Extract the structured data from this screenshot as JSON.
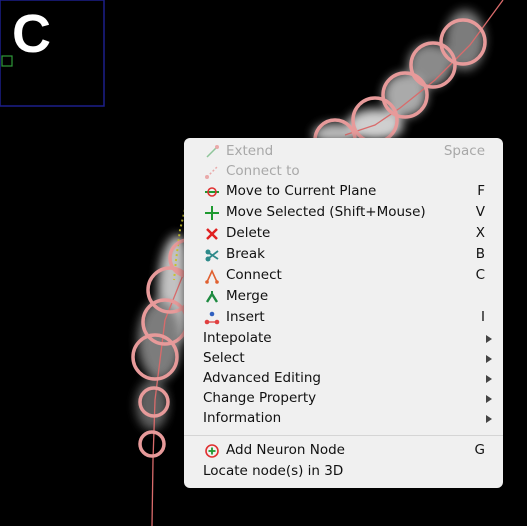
{
  "panel_label": "C",
  "menu": {
    "items": [
      {
        "label": "Extend",
        "shortcut": "Space",
        "icon": "extend-icon",
        "disabled": true
      },
      {
        "label": "Connect to",
        "shortcut": "",
        "icon": "connect-to-icon",
        "disabled": true
      },
      {
        "label": "Move to Current Plane",
        "shortcut": "F",
        "icon": "move-plane-icon"
      },
      {
        "label": "Move Selected (Shift+Mouse)",
        "shortcut": "V",
        "icon": "move-selected-icon"
      },
      {
        "label": "Delete",
        "shortcut": "X",
        "icon": "delete-icon"
      },
      {
        "label": "Break",
        "shortcut": "B",
        "icon": "break-icon"
      },
      {
        "label": "Connect",
        "shortcut": "C",
        "icon": "connect-icon"
      },
      {
        "label": "Merge",
        "shortcut": "",
        "icon": "merge-icon"
      },
      {
        "label": "Insert",
        "shortcut": "I",
        "icon": "insert-icon"
      },
      {
        "label": "Intepolate",
        "submenu": true
      },
      {
        "label": "Select",
        "submenu": true
      },
      {
        "label": "Advanced Editing",
        "submenu": true
      },
      {
        "label": "Change Property",
        "submenu": true
      },
      {
        "label": "Information",
        "submenu": true
      },
      {
        "label": "Add Neuron Node",
        "shortcut": "G",
        "icon": "add-node-icon"
      },
      {
        "label": "Locate node(s) in 3D"
      }
    ]
  },
  "colors": {
    "node_circle": "#e79a9a",
    "trace_line": "#d96b6b",
    "frame": "#1c1f8a",
    "marker": "#2f9a3a"
  }
}
